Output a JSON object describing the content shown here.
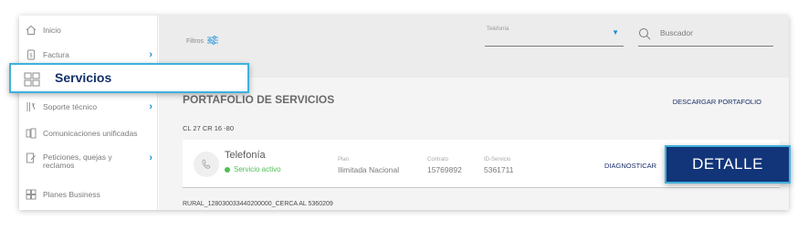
{
  "sidebar": {
    "items": [
      {
        "label": "Inicio",
        "icon": "home-icon"
      },
      {
        "label": "Factura",
        "icon": "invoice-icon",
        "has_submenu": true
      },
      {
        "label": "Servicios",
        "icon": "grid-icon"
      },
      {
        "label": "Soporte técnico",
        "icon": "tools-icon",
        "has_submenu": true
      },
      {
        "label": "Comunicaciones unificadas",
        "icon": "communications-icon"
      },
      {
        "label": "Peticiones, quejas y reclamos",
        "icon": "edit-document-icon",
        "has_submenu": true
      },
      {
        "label": "Planes Business",
        "icon": "plans-grid-icon"
      }
    ]
  },
  "topbar": {
    "filters_label": "Filtros",
    "telefonia_label": "Telefonía",
    "search_placeholder": "Buscador"
  },
  "portfolio": {
    "title": "PORTAFOLIO DE SERVICIOS",
    "download_label": "DESCARGAR PORTAFOLIO",
    "address_1": "CL 27 CR 16 -80",
    "address_2": "RURAL_128030033440200000_CERCA AL 5360209",
    "service": {
      "name": "Telefonía",
      "status": "Servicio activo",
      "plan_label": "Plan",
      "plan_value": "Ilimitada Nacional",
      "contract_label": "Contrato",
      "contract_value": "15769892",
      "id_label": "ID-Servicio",
      "id_value": "5361711",
      "diagnose_label": "DIAGNOSTICAR",
      "detail_label": "DETALLE"
    }
  },
  "colors": {
    "accent_blue": "#1b8fd6",
    "highlight_border": "#3eb1de",
    "navy": "#123478",
    "status_green": "#4fbf55"
  }
}
